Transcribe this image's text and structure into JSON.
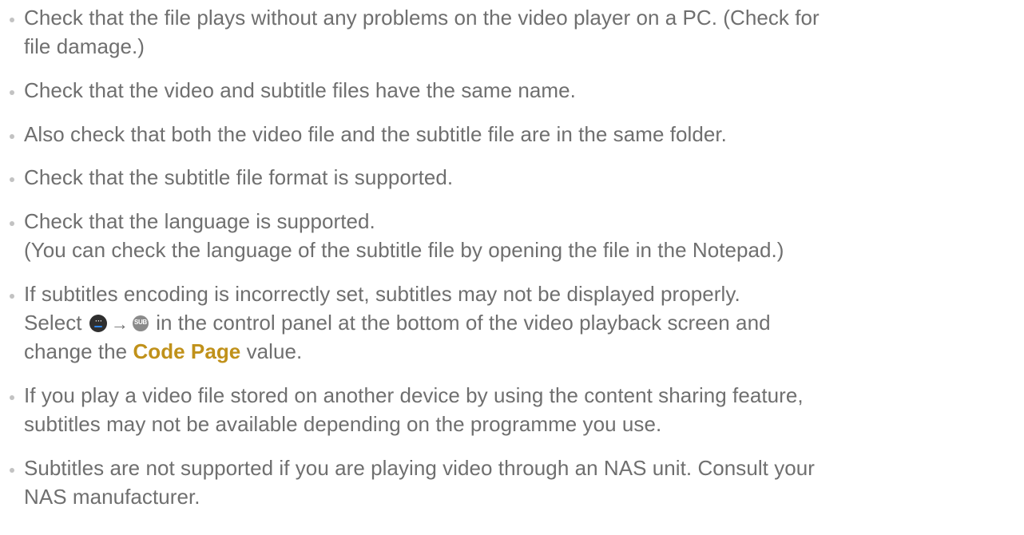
{
  "items": [
    {
      "lines": [
        "Check that the file plays without any problems on the video player on a PC. (Check for",
        "file damage.)"
      ]
    },
    {
      "lines": [
        "Check that the video and subtitle files have the same name."
      ]
    },
    {
      "lines": [
        "Also check that both the video file and the subtitle file are in the same folder."
      ]
    },
    {
      "lines": [
        "Check that the subtitle file format is supported."
      ]
    },
    {
      "lines": [
        "Check that the language is supported.",
        "(You can check the language of the subtitle file by opening the file in the Notepad.)"
      ]
    },
    {
      "line1": "If subtitles encoding is incorrectly set, subtitles may not be displayed properly.",
      "line2_start": "Select",
      "arrow": "→",
      "line2_end": "in the control panel at the bottom of the video playback screen and",
      "line3_start": "change the",
      "highlight": "Code Page",
      "line3_end": "value.",
      "more_icon": "more-options-icon",
      "sub_icon": "subtitle-icon",
      "sub_icon_text": "SUB",
      "more_icon_glyph": "···"
    },
    {
      "lines": [
        "If you play a video file stored on another device by using the content sharing feature,",
        "subtitles may not be available depending on the programme you use."
      ]
    },
    {
      "lines": [
        "Subtitles are not supported if you are playing video through an NAS unit. Consult your",
        "NAS manufacturer."
      ]
    }
  ],
  "colors": {
    "text": "#6f6f6f",
    "bullet": "#c2c2c2",
    "highlight": "#c0911a",
    "icon_dark": "#2f2f2f",
    "icon_accent": "#2f86e8",
    "icon_grey": "#8a8a8a"
  }
}
